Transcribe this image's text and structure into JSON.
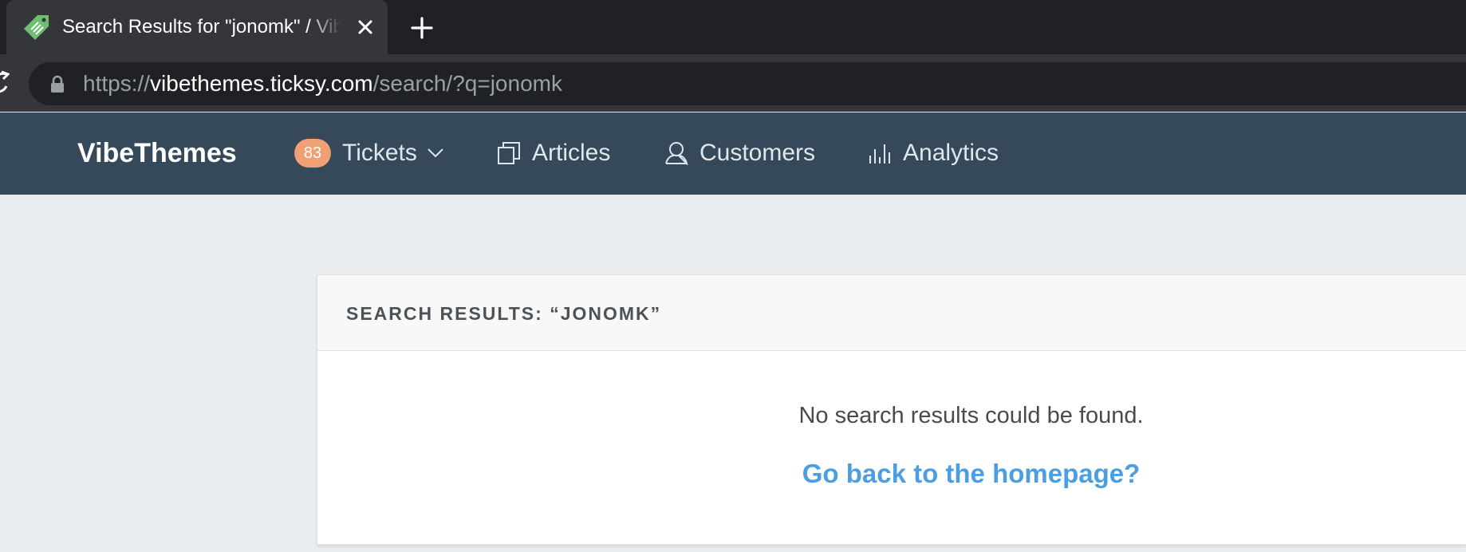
{
  "browser": {
    "tab": {
      "title": "Search Results for \"jonomk\" / VibeThemes"
    },
    "address": {
      "scheme": "https://",
      "host": "vibethemes.ticksy.com",
      "path": "/search/?q=jonomk"
    }
  },
  "app": {
    "brand": "VibeThemes",
    "nav": {
      "tickets": {
        "label": "Tickets",
        "badge": "83"
      },
      "articles": {
        "label": "Articles"
      },
      "customers": {
        "label": "Customers"
      },
      "analytics": {
        "label": "Analytics"
      }
    }
  },
  "results": {
    "title": "SEARCH RESULTS: “JONOMK”",
    "empty_message": "No search results could be found.",
    "home_link": "Go back to the homepage?"
  },
  "colors": {
    "header_bg": "#36495a",
    "badge_bg": "#f0a073",
    "link": "#4d9ee0",
    "page_bg": "#e8ecef"
  }
}
